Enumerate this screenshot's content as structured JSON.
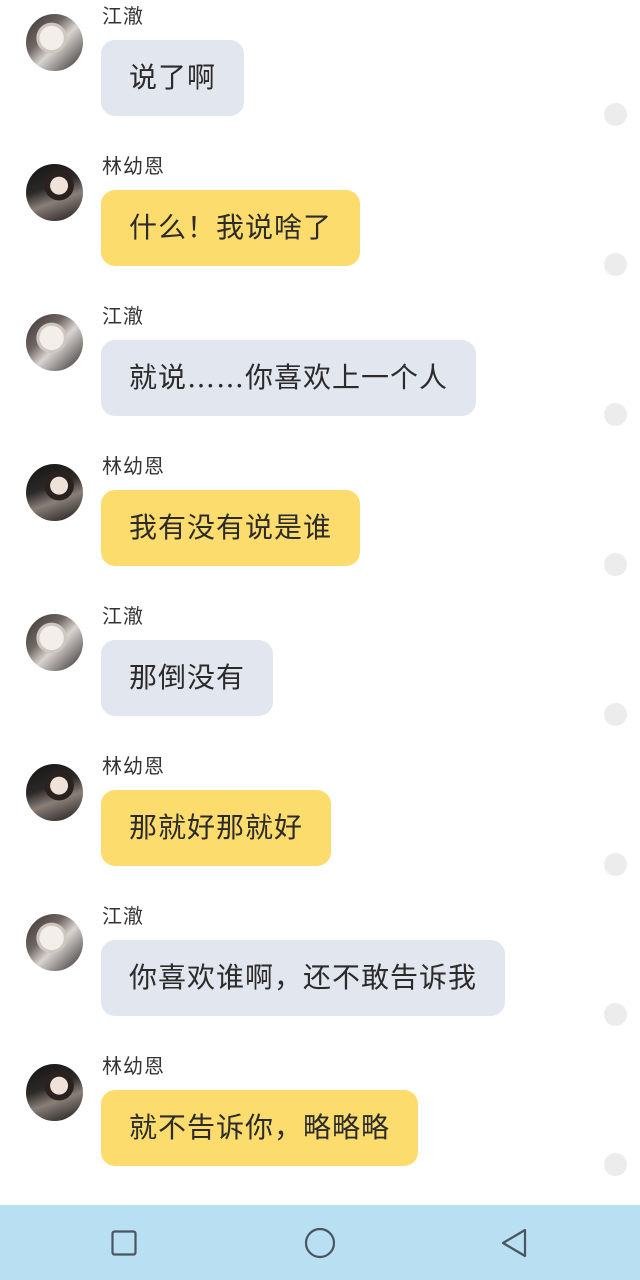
{
  "messages": [
    {
      "sender": "江澈",
      "text": "说了啊",
      "side": "jiang"
    },
    {
      "sender": "林幼恩",
      "text": "什么！我说啥了",
      "side": "lin"
    },
    {
      "sender": "江澈",
      "text": "就说……你喜欢上一个人",
      "side": "jiang"
    },
    {
      "sender": "林幼恩",
      "text": "我有没有说是谁",
      "side": "lin"
    },
    {
      "sender": "江澈",
      "text": "那倒没有",
      "side": "jiang"
    },
    {
      "sender": "林幼恩",
      "text": "那就好那就好",
      "side": "lin"
    },
    {
      "sender": "江澈",
      "text": "你喜欢谁啊，还不敢告诉我",
      "side": "jiang"
    },
    {
      "sender": "林幼恩",
      "text": "就不告诉你，略略略",
      "side": "lin"
    }
  ],
  "colors": {
    "jiang_bubble": "#e1e6ef",
    "lin_bubble": "#fddc6e",
    "navbar": "#b8dff2"
  },
  "navbar": {
    "buttons": [
      "recent-apps-icon",
      "home-icon",
      "back-icon"
    ]
  }
}
